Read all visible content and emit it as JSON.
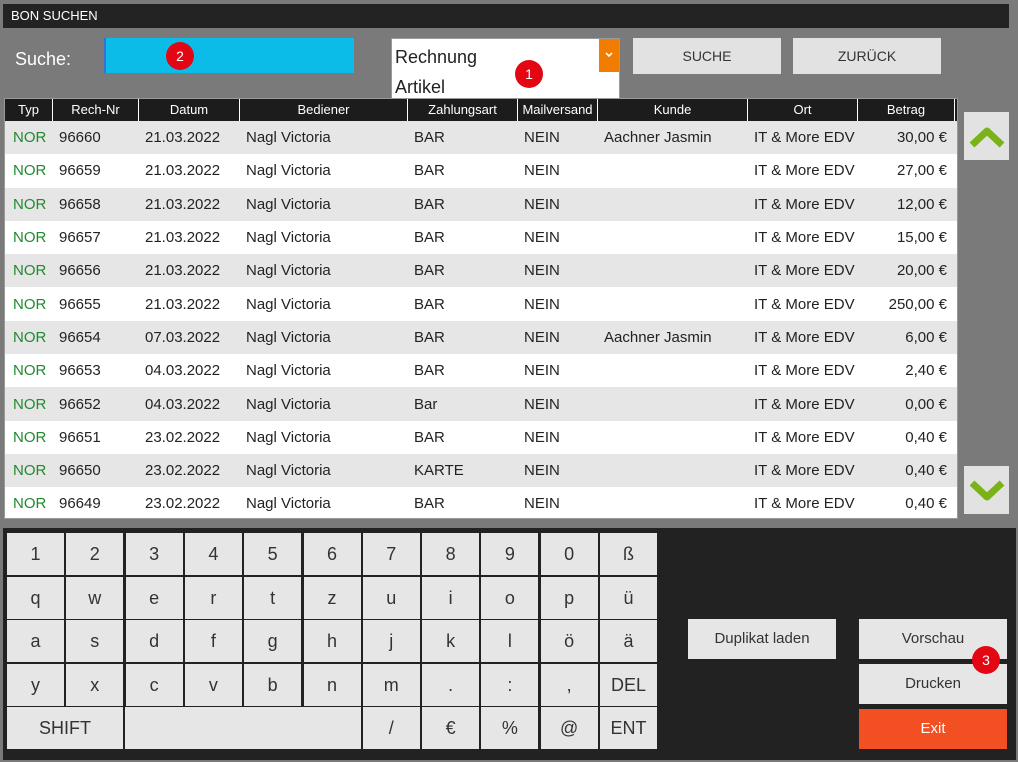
{
  "title": "BON SUCHEN",
  "search": {
    "label": "Suche:",
    "value": "",
    "badge": "2"
  },
  "combo": {
    "options": [
      "Rechnung",
      "Artikel"
    ],
    "chevron": "chevron-down-icon",
    "badge": "1"
  },
  "buttons": {
    "suche": "SUCHE",
    "zurueck": "ZURÜCK"
  },
  "table": {
    "columns": [
      "Typ",
      "Rech-Nr",
      "Datum",
      "Bediener",
      "Zahlungsart",
      "Mailversand",
      "Kunde",
      "Ort",
      "Betrag"
    ],
    "rows": [
      [
        "NOR",
        "96660",
        "21.03.2022",
        "Nagl Victoria",
        "BAR",
        "NEIN",
        "Aachner Jasmin",
        "IT & More EDV",
        "30,00 €"
      ],
      [
        "NOR",
        "96659",
        "21.03.2022",
        "Nagl Victoria",
        "BAR",
        "NEIN",
        "",
        "IT & More EDV",
        "27,00 €"
      ],
      [
        "NOR",
        "96658",
        "21.03.2022",
        "Nagl Victoria",
        "BAR",
        "NEIN",
        "",
        "IT & More EDV",
        "12,00 €"
      ],
      [
        "NOR",
        "96657",
        "21.03.2022",
        "Nagl Victoria",
        "BAR",
        "NEIN",
        "",
        "IT & More EDV",
        "15,00 €"
      ],
      [
        "NOR",
        "96656",
        "21.03.2022",
        "Nagl Victoria",
        "BAR",
        "NEIN",
        "",
        "IT & More EDV",
        "20,00 €"
      ],
      [
        "NOR",
        "96655",
        "21.03.2022",
        "Nagl Victoria",
        "BAR",
        "NEIN",
        "",
        "IT & More EDV",
        "250,00 €"
      ],
      [
        "NOR",
        "96654",
        "07.03.2022",
        "Nagl Victoria",
        "BAR",
        "NEIN",
        " Aachner Jasmin",
        "IT & More EDV",
        "6,00 €"
      ],
      [
        "NOR",
        "96653",
        "04.03.2022",
        "Nagl Victoria",
        "BAR",
        "NEIN",
        "",
        "IT & More EDV",
        "2,40 €"
      ],
      [
        "NOR",
        "96652",
        "04.03.2022",
        "Nagl Victoria",
        "Bar",
        "NEIN",
        "",
        "IT & More EDV",
        "0,00 €"
      ],
      [
        "NOR",
        "96651",
        "23.02.2022",
        "Nagl Victoria",
        "BAR",
        "NEIN",
        "",
        "IT & More EDV",
        "0,40 €"
      ],
      [
        "NOR",
        "96650",
        "23.02.2022",
        "Nagl Victoria",
        "KARTE",
        "NEIN",
        "",
        "IT & More EDV",
        "0,40 €"
      ],
      [
        "NOR",
        "96649",
        "23.02.2022",
        "Nagl Victoria",
        "BAR",
        "NEIN",
        "",
        "IT & More EDV",
        "0,40 €"
      ]
    ]
  },
  "scroll": {
    "up": "chevron-up-icon",
    "down": "chevron-down-icon",
    "color": "#7ab317"
  },
  "keyboard": {
    "row1": [
      "1",
      "2",
      "3",
      "4",
      "5",
      "6",
      "7",
      "8",
      "9",
      "0",
      "ß"
    ],
    "row2": [
      "q",
      "w",
      "e",
      "r",
      "t",
      "z",
      "u",
      "i",
      "o",
      "p",
      "ü"
    ],
    "row3": [
      "a",
      "s",
      "d",
      "f",
      "g",
      "h",
      "j",
      "k",
      "l",
      "ö",
      "ä"
    ],
    "row4": [
      "y",
      "x",
      "c",
      "v",
      "b",
      "n",
      "m",
      ".",
      ":",
      ",",
      "DEL"
    ],
    "row5": [
      "SHIFT",
      "",
      "/",
      "€",
      "%",
      "@",
      "ENT"
    ]
  },
  "actions": {
    "duplikat": "Duplikat laden",
    "vorschau": "Vorschau",
    "drucken": "Drucken",
    "exit": "Exit",
    "badge": "3"
  },
  "colors": {
    "accent_orange": "#f07c00",
    "search_blue": "#0bbce8",
    "exit_red": "#f24f22",
    "badge_red": "#e30613",
    "typ_green": "#1f8a2e"
  }
}
